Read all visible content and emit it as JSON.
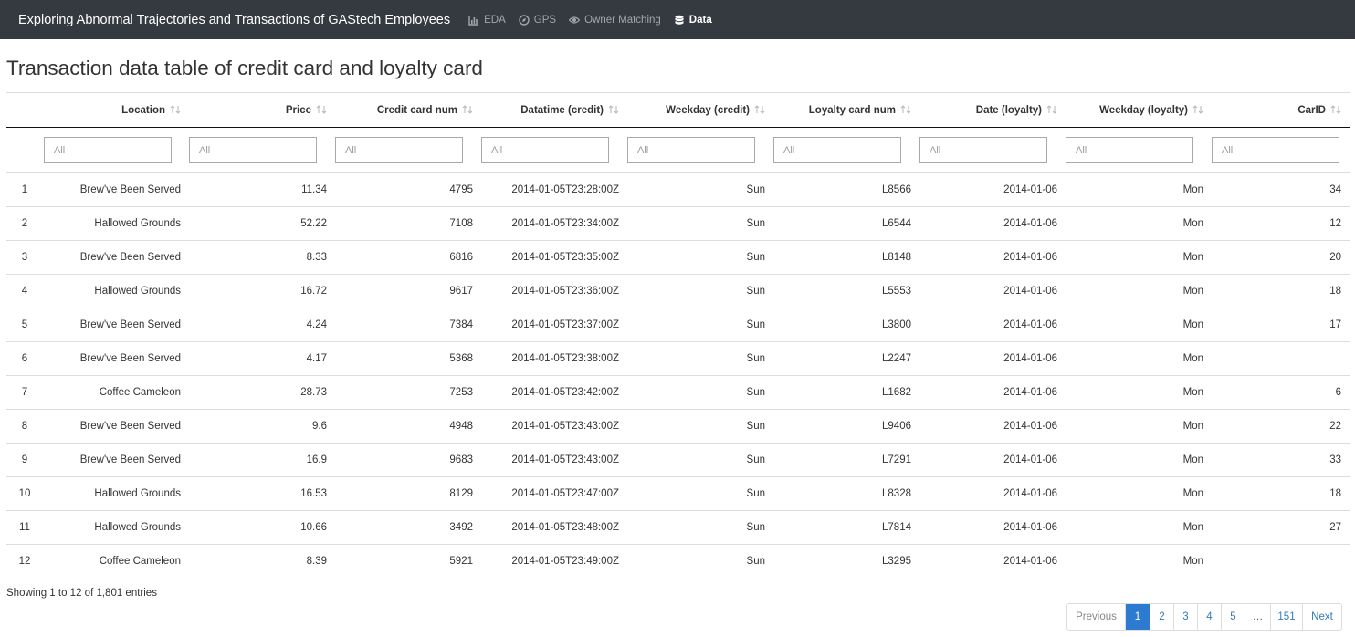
{
  "navbar": {
    "brand": "Exploring Abnormal Trajectories and Transactions of GAStech Employees",
    "items": [
      {
        "label": "EDA",
        "icon": "bar-chart-icon"
      },
      {
        "label": "GPS",
        "icon": "compass-icon"
      },
      {
        "label": "Owner Matching",
        "icon": "eye-icon"
      },
      {
        "label": "Data",
        "icon": "database-icon",
        "active": true
      }
    ]
  },
  "page_title": "Transaction data table of credit card and loyalty card",
  "table": {
    "columns": [
      "Location",
      "Price",
      "Credit card num",
      "Datatime (credit)",
      "Weekday (credit)",
      "Loyalty card num",
      "Date (loyalty)",
      "Weekday (loyalty)",
      "CarID"
    ],
    "filter_placeholder": "All",
    "rows": [
      [
        "1",
        "Brew've Been Served",
        "11.34",
        "4795",
        "2014-01-05T23:28:00Z",
        "Sun",
        "L8566",
        "2014-01-06",
        "Mon",
        "34"
      ],
      [
        "2",
        "Hallowed Grounds",
        "52.22",
        "7108",
        "2014-01-05T23:34:00Z",
        "Sun",
        "L6544",
        "2014-01-06",
        "Mon",
        "12"
      ],
      [
        "3",
        "Brew've Been Served",
        "8.33",
        "6816",
        "2014-01-05T23:35:00Z",
        "Sun",
        "L8148",
        "2014-01-06",
        "Mon",
        "20"
      ],
      [
        "4",
        "Hallowed Grounds",
        "16.72",
        "9617",
        "2014-01-05T23:36:00Z",
        "Sun",
        "L5553",
        "2014-01-06",
        "Mon",
        "18"
      ],
      [
        "5",
        "Brew've Been Served",
        "4.24",
        "7384",
        "2014-01-05T23:37:00Z",
        "Sun",
        "L3800",
        "2014-01-06",
        "Mon",
        "17"
      ],
      [
        "6",
        "Brew've Been Served",
        "4.17",
        "5368",
        "2014-01-05T23:38:00Z",
        "Sun",
        "L2247",
        "2014-01-06",
        "Mon",
        ""
      ],
      [
        "7",
        "Coffee Cameleon",
        "28.73",
        "7253",
        "2014-01-05T23:42:00Z",
        "Sun",
        "L1682",
        "2014-01-06",
        "Mon",
        "6"
      ],
      [
        "8",
        "Brew've Been Served",
        "9.6",
        "4948",
        "2014-01-05T23:43:00Z",
        "Sun",
        "L9406",
        "2014-01-06",
        "Mon",
        "22"
      ],
      [
        "9",
        "Brew've Been Served",
        "16.9",
        "9683",
        "2014-01-05T23:43:00Z",
        "Sun",
        "L7291",
        "2014-01-06",
        "Mon",
        "33"
      ],
      [
        "10",
        "Hallowed Grounds",
        "16.53",
        "8129",
        "2014-01-05T23:47:00Z",
        "Sun",
        "L8328",
        "2014-01-06",
        "Mon",
        "18"
      ],
      [
        "11",
        "Hallowed Grounds",
        "10.66",
        "3492",
        "2014-01-05T23:48:00Z",
        "Sun",
        "L7814",
        "2014-01-06",
        "Mon",
        "27"
      ],
      [
        "12",
        "Coffee Cameleon",
        "8.39",
        "5921",
        "2014-01-05T23:49:00Z",
        "Sun",
        "L3295",
        "2014-01-06",
        "Mon",
        ""
      ]
    ]
  },
  "info": "Showing 1 to 12 of 1,801 entries",
  "pagination": {
    "previous": "Previous",
    "pages": [
      "1",
      "2",
      "3",
      "4",
      "5",
      "…",
      "151"
    ],
    "current": "1",
    "next": "Next"
  }
}
